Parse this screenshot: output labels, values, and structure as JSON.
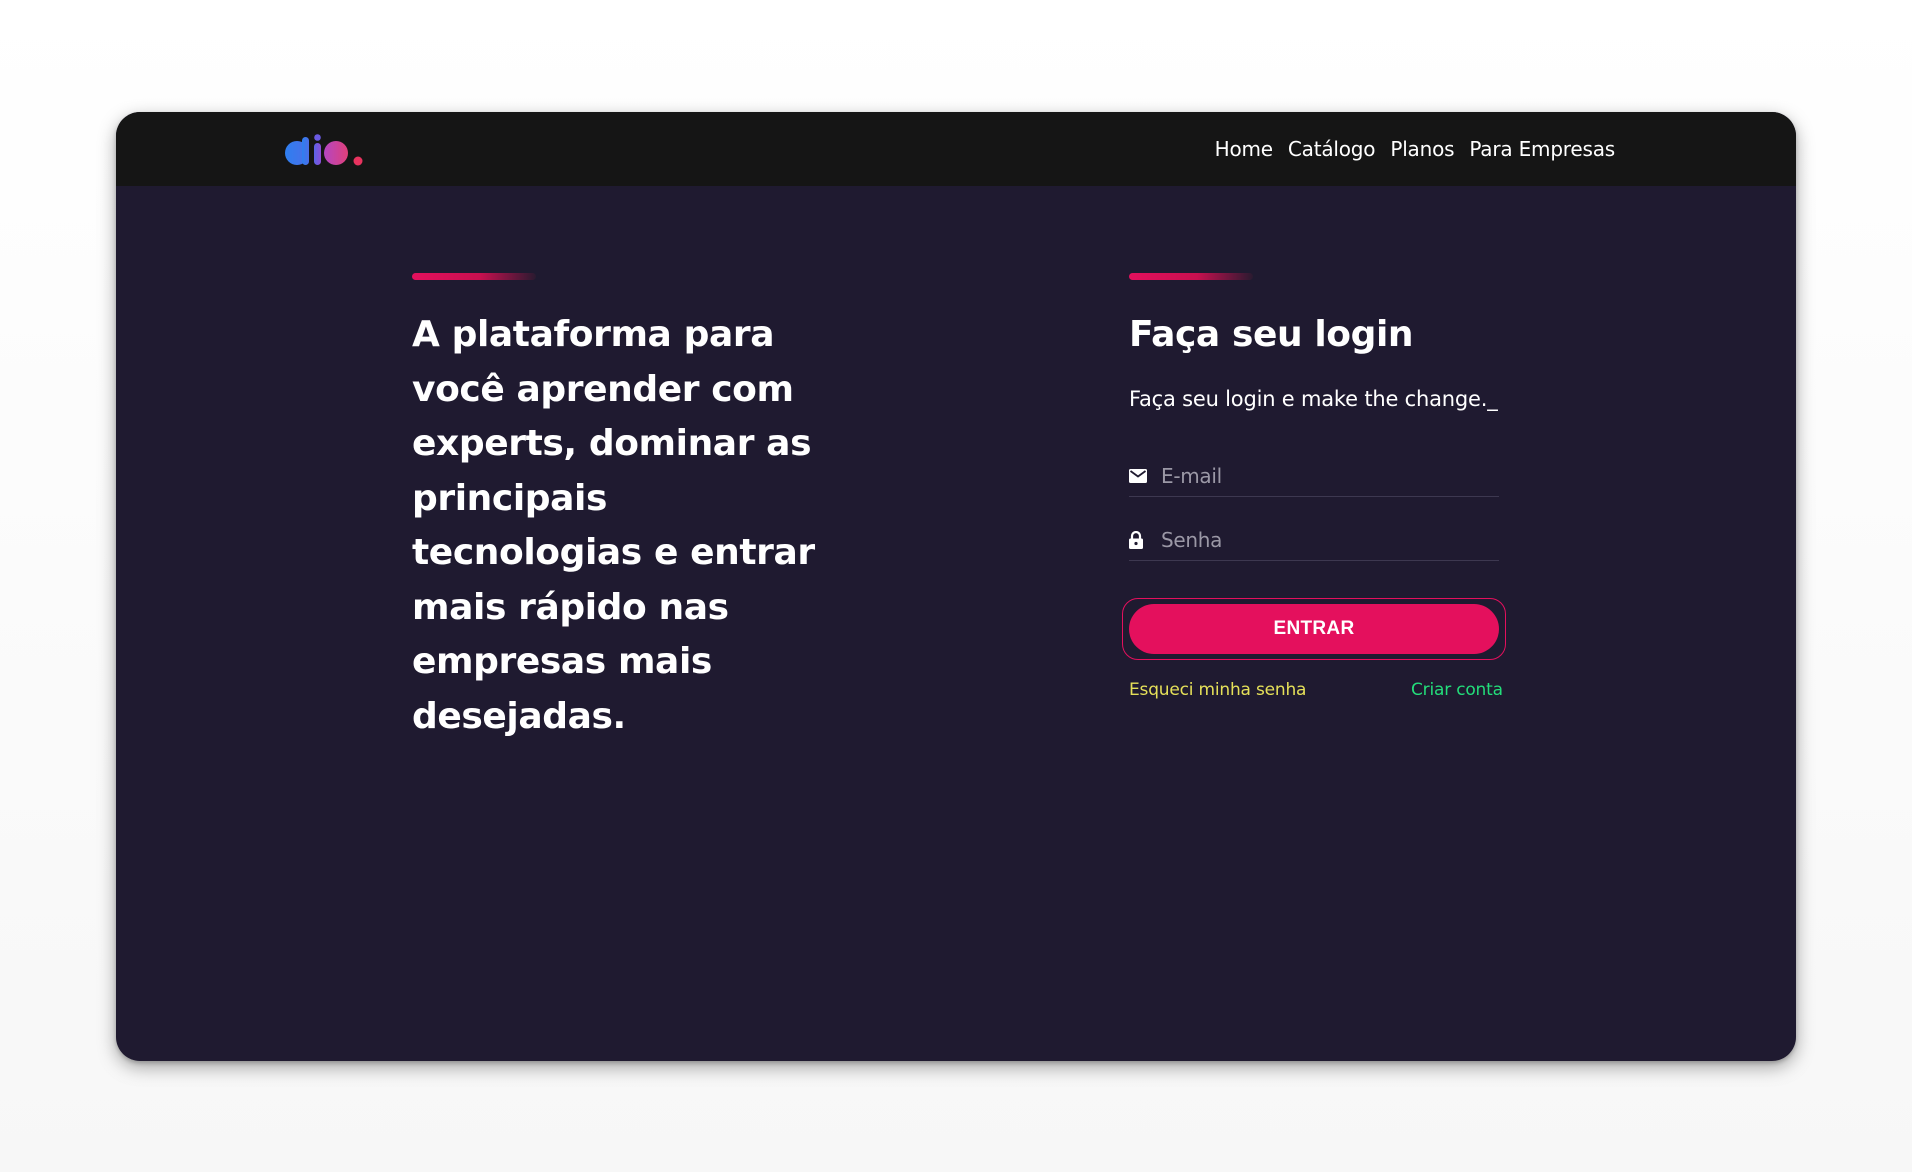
{
  "header": {
    "logo_alt": "dio",
    "nav": [
      {
        "label": "Home"
      },
      {
        "label": "Catálogo"
      },
      {
        "label": "Planos"
      },
      {
        "label": "Para Empresas"
      }
    ]
  },
  "hero": {
    "title": "A plataforma para você aprender com experts, dominar as principais tecnologias e entrar mais rápido nas empresas mais desejadas."
  },
  "login": {
    "title": "Faça seu login",
    "subtitle": "Faça seu login e make the change._",
    "email_placeholder": "E-mail",
    "email_icon": "mail-icon",
    "password_placeholder": "Senha",
    "password_icon": "lock-icon",
    "submit_label": "ENTRAR",
    "forgot_label": "Esqueci minha senha",
    "create_label": "Criar conta"
  },
  "colors": {
    "page_bg": "#1f1a30",
    "header_bg": "#151515",
    "accent": "#e4105d",
    "forgot_link": "#e5e059",
    "create_link": "#23dd7a"
  }
}
